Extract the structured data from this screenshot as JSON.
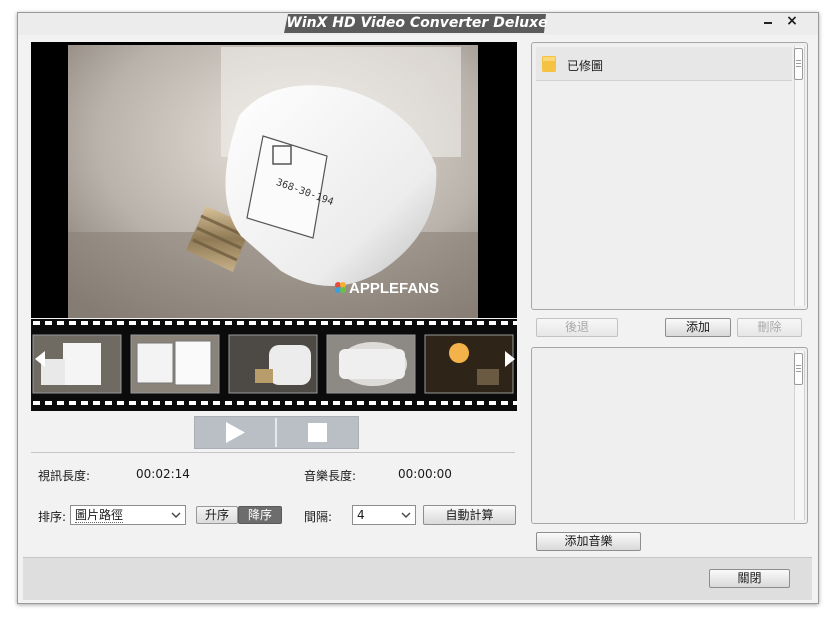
{
  "window": {
    "title": "WinX HD Video Converter Deluxe",
    "minimize": "_",
    "close": "×"
  },
  "preview": {
    "watermark": "APPLEFANS",
    "label_text": "368-30-194"
  },
  "info": {
    "video_length_label": "視訊長度:",
    "video_length_value": "00:02:14",
    "music_length_label": "音樂長度:",
    "music_length_value": "00:00:00"
  },
  "sort": {
    "label": "排序:",
    "selected": "圖片路徑",
    "ascending_label": "升序",
    "descending_label": "降序"
  },
  "interval": {
    "label": "間隔:",
    "selected": "4",
    "auto_calc_label": "自動計算"
  },
  "image_list": {
    "folder_name": "已修圖",
    "back_label": "後退",
    "add_label": "添加",
    "delete_label": "刪除"
  },
  "music": {
    "add_music_label": "添加音樂"
  },
  "footer": {
    "close_label": "關閉"
  },
  "colors": {
    "accent_desc": "#6d6d6d",
    "title_tab": "#5b5b5b",
    "folder": "#f6c244"
  }
}
